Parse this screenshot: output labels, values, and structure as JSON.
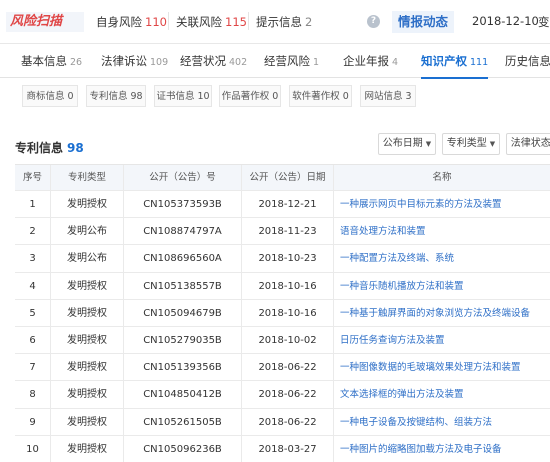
{
  "risk_bar": {
    "logo": "风险扫描",
    "self_risk_label": "自身风险",
    "self_risk_count": "110",
    "related_risk_label": "关联风险",
    "related_risk_count": "115",
    "notice_label": "提示信息",
    "notice_count": "2",
    "help_icon": "?",
    "intel_label": "情报动态",
    "date": "2018-12-10",
    "change_label": "变"
  },
  "main_tabs": [
    {
      "label": "基本信息",
      "count": "26"
    },
    {
      "label": "法律诉讼",
      "count": "109"
    },
    {
      "label": "经营状况",
      "count": "402"
    },
    {
      "label": "经营风险",
      "count": "1"
    },
    {
      "label": "企业年报",
      "count": "4"
    },
    {
      "label": "知识产权",
      "count": "111",
      "active": true
    },
    {
      "label": "历史信息",
      "count": ""
    }
  ],
  "sub_tabs": [
    "商标信息 0",
    "专利信息 98",
    "证书信息 10",
    "作品著作权 0",
    "软件著作权 0",
    "网站信息 3"
  ],
  "section": {
    "title": "专利信息",
    "count": "98",
    "filters": [
      "公布日期",
      "专利类型",
      "法律状态"
    ]
  },
  "table": {
    "headers": [
      "序号",
      "专利类型",
      "公开（公告）号",
      "公开（公告）日期",
      "名称"
    ],
    "rows": [
      [
        "1",
        "发明授权",
        "CN105373593B",
        "2018-12-21",
        "一种展示网页中目标元素的方法及装置"
      ],
      [
        "2",
        "发明公布",
        "CN108874797A",
        "2018-11-23",
        "语音处理方法和装置"
      ],
      [
        "3",
        "发明公布",
        "CN108696560A",
        "2018-10-23",
        "一种配置方法及终端、系统"
      ],
      [
        "4",
        "发明授权",
        "CN105138557B",
        "2018-10-16",
        "一种音乐随机播放方法和装置"
      ],
      [
        "5",
        "发明授权",
        "CN105094679B",
        "2018-10-16",
        "一种基于触屏界面的对象浏览方法及终端设备"
      ],
      [
        "6",
        "发明授权",
        "CN105279035B",
        "2018-10-02",
        "日历任务查询方法及装置"
      ],
      [
        "7",
        "发明授权",
        "CN105139356B",
        "2018-06-22",
        "一种图像数据的毛玻璃效果处理方法和装置"
      ],
      [
        "8",
        "发明授权",
        "CN104850412B",
        "2018-06-22",
        "文本选择框的弹出方法及装置"
      ],
      [
        "9",
        "发明授权",
        "CN105261505B",
        "2018-06-22",
        "一种电子设备及按键结构、组装方法"
      ],
      [
        "10",
        "发明授权",
        "CN105096236B",
        "2018-03-27",
        "一种图片的缩略图加载方法及电子设备"
      ]
    ]
  }
}
